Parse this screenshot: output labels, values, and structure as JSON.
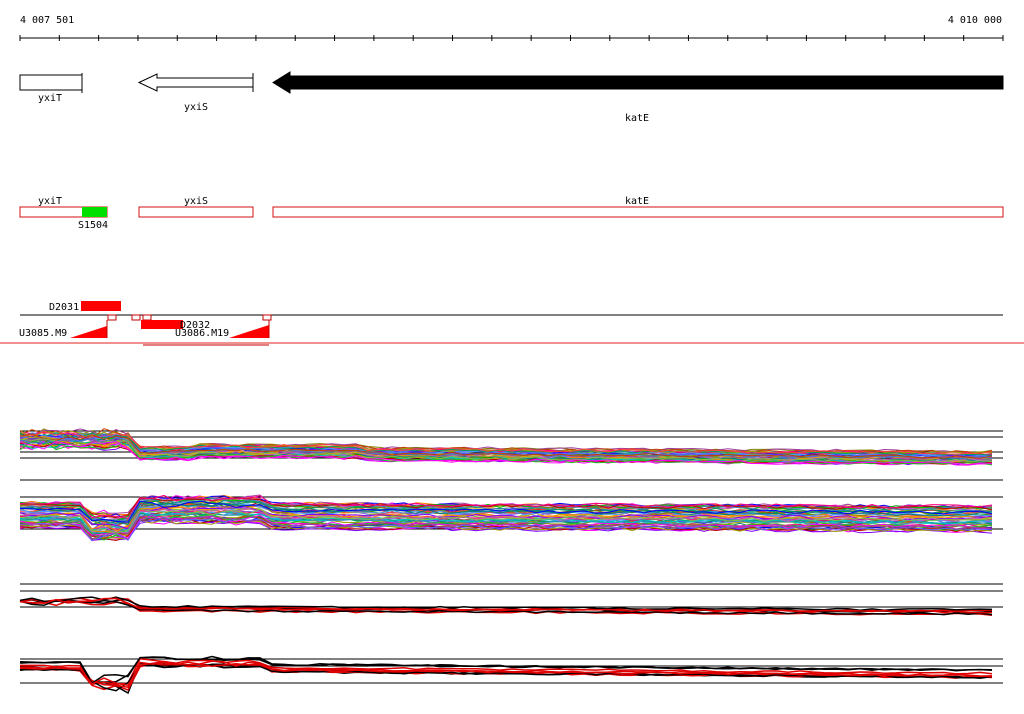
{
  "ruler": {
    "start_label": "4 007 501",
    "end_label": "4 010 000"
  },
  "genes": [
    {
      "name": "yxiT",
      "strand": "forward",
      "fill": "outline"
    },
    {
      "name": "yxiS",
      "strand": "reverse",
      "fill": "outline"
    },
    {
      "name": "katE",
      "strand": "reverse",
      "fill": "solid"
    }
  ],
  "transcripts": [
    {
      "name": "yxiT",
      "color": "#d01010"
    },
    {
      "name": "yxiS",
      "color": "#d01010"
    },
    {
      "name": "katE",
      "color": "#d01010"
    }
  ],
  "feature": {
    "name": "S1504",
    "color": "#00e000"
  },
  "upstream": [
    {
      "name": "D2031",
      "color": "#ff0000"
    },
    {
      "name": "D2032",
      "color": "#ff0000"
    },
    {
      "name": "U3085.M9",
      "color": "#ff0000"
    },
    {
      "name": "U3086.M19",
      "color": "#ff0000"
    }
  ]
}
